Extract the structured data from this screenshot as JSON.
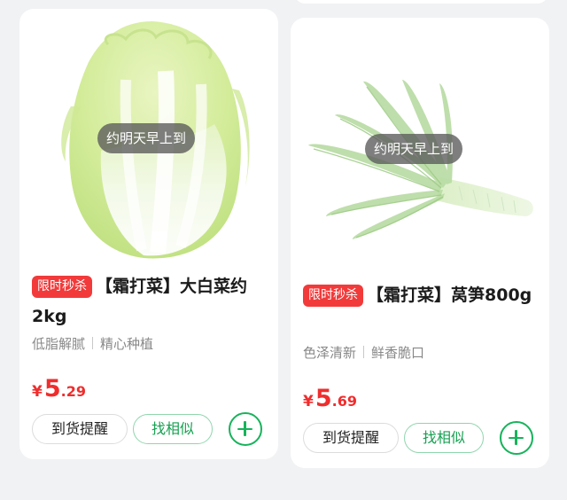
{
  "products": [
    {
      "image_icon": "napa-cabbage-image",
      "eta_label": "约明天早上到",
      "badge": "限时秒杀",
      "title": "【霜打菜】大白菜约2kg",
      "tag1": "低脂解腻",
      "tag2": "精心种植",
      "currency": "¥",
      "price_int": "5",
      "price_dec": ".29",
      "notify_label": "到货提醒",
      "similar_label": "找相似",
      "add_icon": "plus-icon"
    },
    {
      "image_icon": "celtuce-image",
      "eta_label": "约明天早上到",
      "badge": "限时秒杀",
      "title": "【霜打菜】莴笋800g",
      "tag1": "色泽清新",
      "tag2": "鲜香脆口",
      "currency": "¥",
      "price_int": "5",
      "price_dec": ".69",
      "notify_label": "到货提醒",
      "similar_label": "找相似",
      "add_icon": "plus-icon"
    }
  ],
  "colors": {
    "accent_green": "#17b35b",
    "price_red": "#f02d2d",
    "badge_red": "#f23a3a"
  }
}
